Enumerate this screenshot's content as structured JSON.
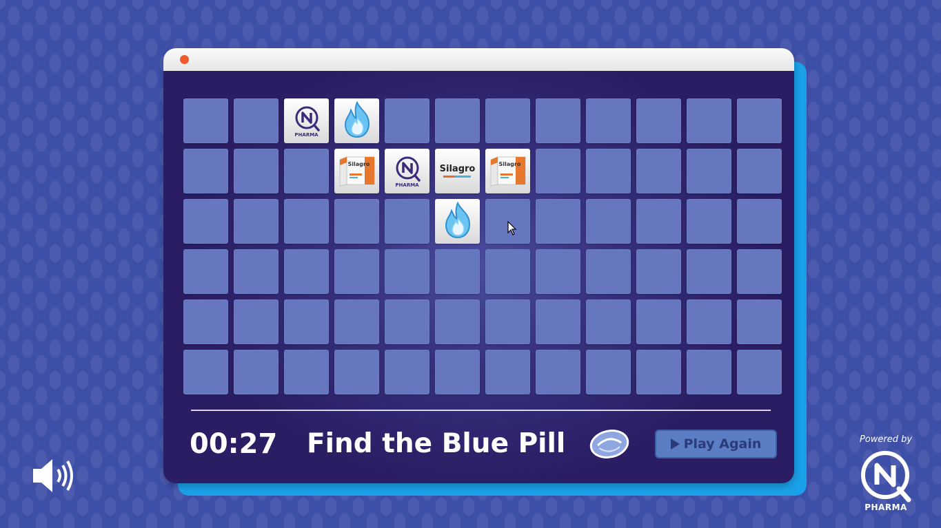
{
  "game": {
    "timer": "00:27",
    "title": "Find the Blue Pill",
    "play_again_label": "Play Again",
    "board": {
      "rows": 6,
      "cols": 12,
      "revealed": [
        {
          "row": 0,
          "col": 2,
          "card": "npharma-logo"
        },
        {
          "row": 0,
          "col": 3,
          "card": "blue-flame"
        },
        {
          "row": 1,
          "col": 3,
          "card": "silagro-box"
        },
        {
          "row": 1,
          "col": 4,
          "card": "npharma-logo"
        },
        {
          "row": 1,
          "col": 5,
          "card": "silagro-text"
        },
        {
          "row": 1,
          "col": 6,
          "card": "silagro-box"
        },
        {
          "row": 2,
          "col": 5,
          "card": "blue-flame"
        }
      ]
    },
    "card_texts": {
      "npharma_label": "PHARMA",
      "silagro_label": "Silagro",
      "silagro_box_label": "Silagro"
    }
  },
  "branding": {
    "powered_by": "Powered by",
    "brand_name": "PHARMA",
    "logo_letter": "N"
  },
  "colors": {
    "background": "#3e4fa8",
    "window": "#2a1d63",
    "tile_hidden": "#6677c0",
    "accent_shadow": "#1aa0e8",
    "close_dot": "#ec5a2e",
    "button": "#5b7dc4"
  },
  "icons": {
    "sound": "speaker-icon",
    "pill": "blue-pill-icon",
    "play": "play-icon"
  }
}
